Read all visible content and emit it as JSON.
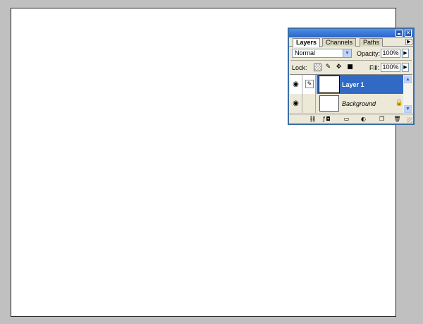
{
  "panel": {
    "tabs": [
      {
        "label": "Layers",
        "active": true
      },
      {
        "label": "Channels",
        "active": false
      },
      {
        "label": "Paths",
        "active": false
      }
    ],
    "blend_mode": "Normal",
    "opacity_label": "Opacity:",
    "opacity_value": "100%",
    "lock_label": "Lock:",
    "fill_label": "Fill:",
    "fill_value": "100%",
    "layers": [
      {
        "name": "Layer 1",
        "selected": true,
        "visible": true
      },
      {
        "name": "Background",
        "selected": false,
        "visible": true,
        "locked": true
      }
    ]
  },
  "colors": {
    "workspace": "#c0c0c0",
    "canvas": "#ffffff",
    "selection": "#316ac5",
    "titlebar": "#2a63c8"
  }
}
